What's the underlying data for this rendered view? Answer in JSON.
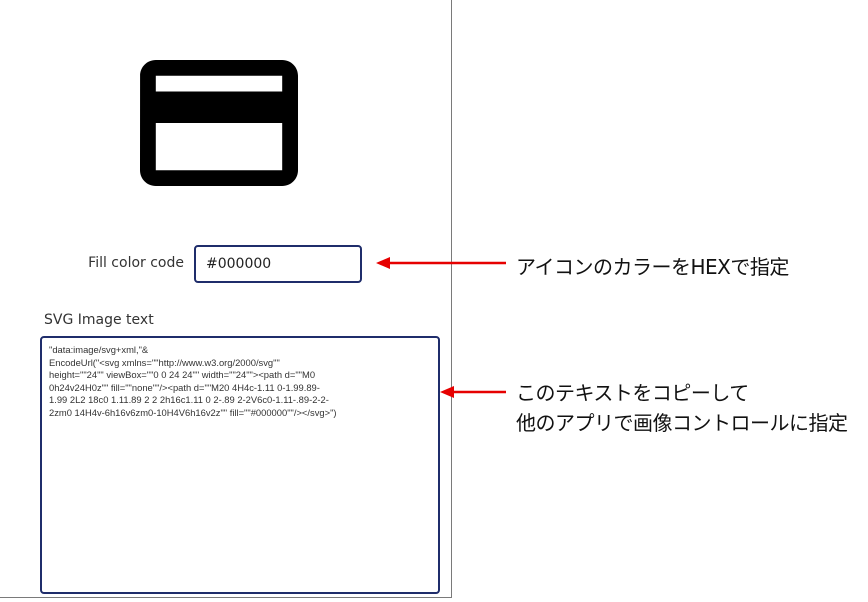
{
  "preview": {
    "icon": "credit-card-icon",
    "fill_color": "#000000"
  },
  "fill_color": {
    "label": "Fill color code",
    "value": "#000000"
  },
  "svg_text": {
    "label": "SVG Image text",
    "value": "\"data:image/svg+xml,\"&\nEncodeUrl(\"<svg xmlns=\"\"http://www.w3.org/2000/svg\"\"\nheight=\"\"24\"\" viewBox=\"\"0 0 24 24\"\" width=\"\"24\"\"><path d=\"\"M0\n0h24v24H0z\"\" fill=\"\"none\"\"/><path d=\"\"M20 4H4c-1.11 0-1.99.89-\n1.99 2L2 18c0 1.11.89 2 2 2h16c1.11 0 2-.89 2-2V6c0-1.11-.89-2-2-\n2zm0 14H4v-6h16v6zm0-10H4V6h16v2z\"\" fill=\"\"#000000\"\"/></svg>\")"
  },
  "annotations": {
    "note1": "アイコンのカラーをHEXで指定",
    "note2_line1": "このテキストをコピーして",
    "note2_line2": "他のアプリで画像コントロールに指定"
  },
  "colors": {
    "arrow": "#e60000",
    "input_border": "#1f2d6b",
    "icon": "#000000"
  }
}
